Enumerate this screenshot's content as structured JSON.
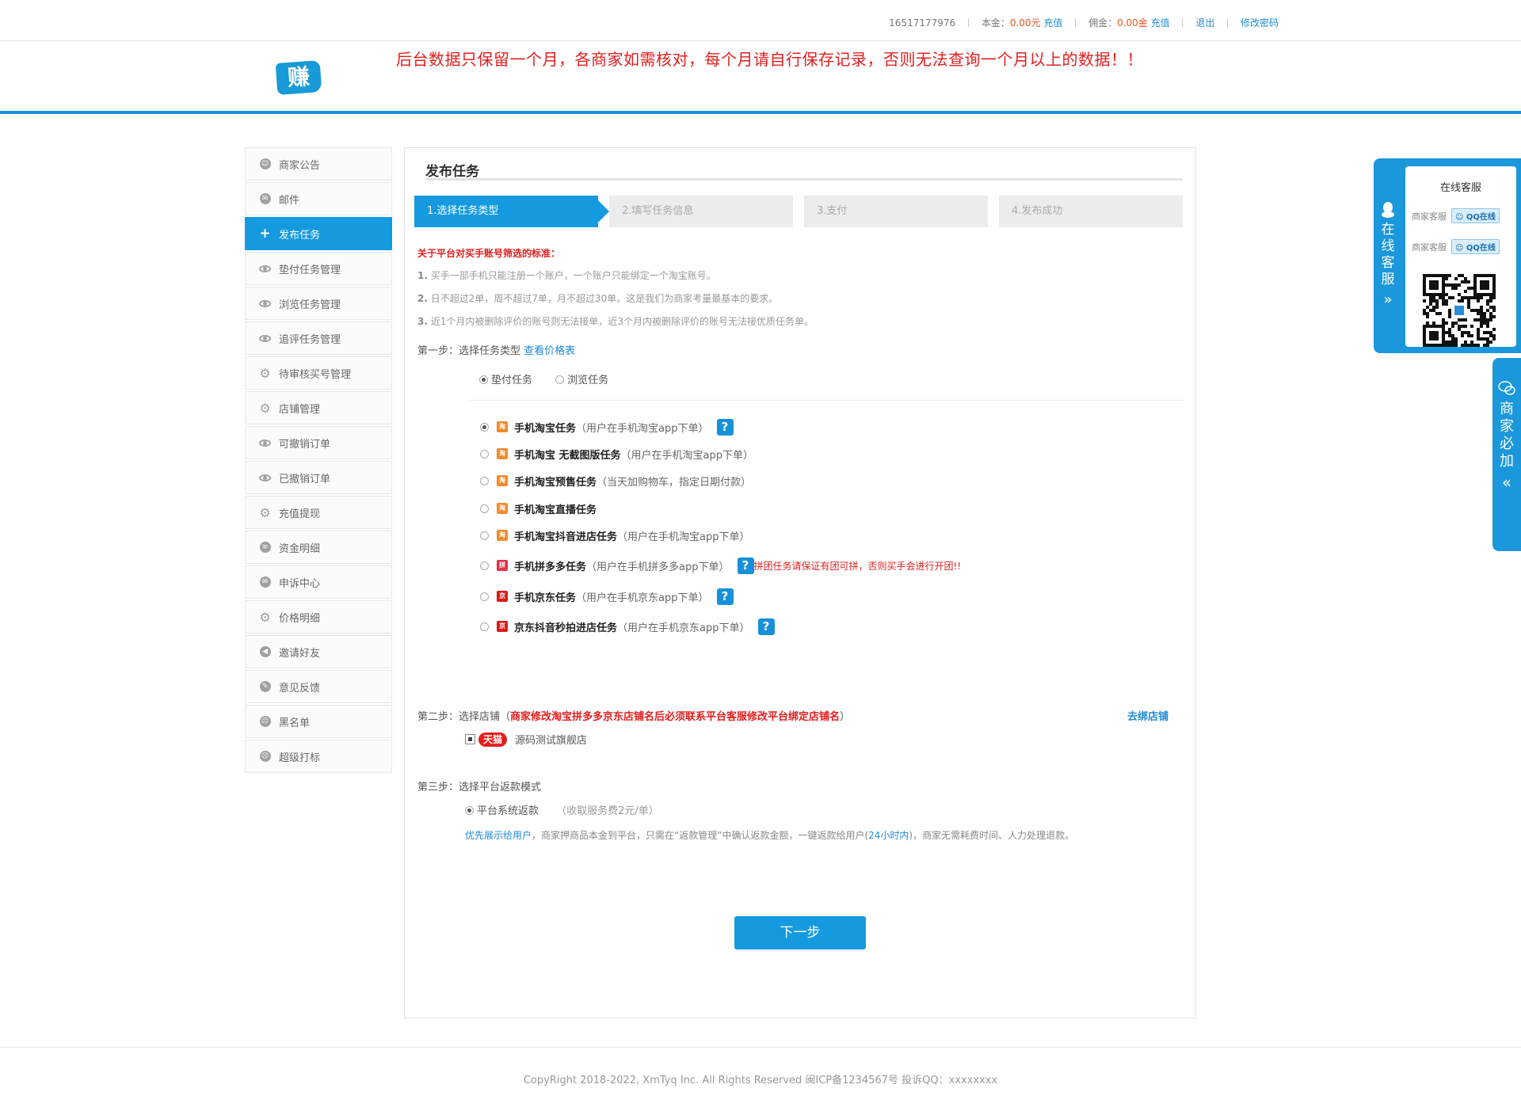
{
  "topbar": {
    "phone": "16517177976",
    "principal_label": "本金：",
    "principal_value": "0.00元",
    "recharge1": "充值",
    "commission_label": "佣金：",
    "commission_value": "0.00金",
    "recharge2": "充值",
    "logout": "退出",
    "change_password": "修改密码"
  },
  "header": {
    "logo_text": "赚",
    "notice": "后台数据只保留一个月，各商家如需核对，每个月请自行保存记录，否则无法查询一个月以上的数据！！"
  },
  "sidebar": {
    "items": [
      {
        "label": "商家公告",
        "icon": "smile-icon"
      },
      {
        "label": "邮件",
        "icon": "chat-icon"
      },
      {
        "label": "发布任务",
        "icon": "plus-icon",
        "active": true
      },
      {
        "label": "垫付任务管理",
        "icon": "eye-icon"
      },
      {
        "label": "浏览任务管理",
        "icon": "eye-icon"
      },
      {
        "label": "追评任务管理",
        "icon": "eye-icon"
      },
      {
        "label": "待审核买号管理",
        "icon": "gear-icon"
      },
      {
        "label": "店铺管理",
        "icon": "gear-icon"
      },
      {
        "label": "可撤销订单",
        "icon": "eye-icon"
      },
      {
        "label": "已撤销订单",
        "icon": "eye-icon"
      },
      {
        "label": "充值提现",
        "icon": "gear-icon"
      },
      {
        "label": "资金明细",
        "icon": "database-icon"
      },
      {
        "label": "申诉中心",
        "icon": "chat-icon"
      },
      {
        "label": "价格明细",
        "icon": "gear-icon"
      },
      {
        "label": "邀请好友",
        "icon": "megaphone-icon"
      },
      {
        "label": "意见反馈",
        "icon": "feedback-icon"
      },
      {
        "label": "黑名单",
        "icon": "sad-icon"
      },
      {
        "label": "超级打标",
        "icon": "sad-icon"
      }
    ]
  },
  "main": {
    "title": "发布任务",
    "steps": [
      "1.选择任务类型",
      "2.填写任务信息",
      "3.支付",
      "4.发布成功"
    ],
    "rules_title": "关于平台对买手账号筛选的标准：",
    "rules": [
      {
        "num": "1.",
        "text": "买手一部手机只能注册一个账户，一个账户只能绑定一个淘宝账号。"
      },
      {
        "num": "2.",
        "text": "日不超过2单，周不超过7单，月不超过30单。这是我们为商家考量最基本的要求。"
      },
      {
        "num": "3.",
        "text": "近1个月内被删除评价的账号则无法接单，近3个月内被删除评价的账号无法接优质任务单。"
      }
    ],
    "step1_label": "第一步：选择任务类型",
    "price_link": "查看价格表",
    "task_kinds": [
      "垫付任务",
      "浏览任务"
    ],
    "tasks": [
      {
        "badge": "淘",
        "name": "手机淘宝任务",
        "desc": "（用户在手机淘宝app下单）",
        "help": "?"
      },
      {
        "badge": "淘",
        "name": "手机淘宝 无截图版任务",
        "desc": "（用户在手机淘宝app下单）"
      },
      {
        "badge": "淘",
        "name": "手机淘宝预售任务",
        "desc": "（当天加购物车，指定日期付款）"
      },
      {
        "badge": "淘",
        "name": "手机淘宝直播任务",
        "desc": ""
      },
      {
        "badge": "淘",
        "name": "手机淘宝抖音进店任务",
        "desc": "（用户在手机淘宝app下单）"
      },
      {
        "badge": "拼",
        "name": "手机拼多多任务",
        "desc": "（用户在手机拼多多app下单）",
        "help": "?",
        "warn": "拼团任务请保证有团可拼，否则买手会进行开团!!"
      },
      {
        "badge": "京",
        "name": "手机京东任务",
        "desc": "（用户在手机京东app下单）",
        "help": "?"
      },
      {
        "badge": "京",
        "name": "京东抖音秒拍进店任务",
        "desc": "（用户在手机京东app下单）",
        "help": "?"
      }
    ],
    "step2_label": "第二步：选择店铺（",
    "step2_warn": "商家修改淘宝拼多多京东店铺名后必须联系平台客服修改平台绑定店铺名",
    "step2_close": "）",
    "bind_shop": "去绑店铺",
    "shop_tag": "天猫",
    "shop_name": "源码测试旗舰店",
    "step3_label": "第三步：选择平台返款模式",
    "refund_mode": "平台系统返款",
    "refund_fee": "（收取服务费2元/单）",
    "refund_desc_pre": "优先展示给用户",
    "refund_desc_mid": "，商家押商品本金到平台，只需在“返款管理”中确认返款金额，一键返款给用户(",
    "refund_desc_hl": "24小时内",
    "refund_desc_post": ")，商家无需耗费时间、人力处理退款。",
    "next_button": "下一步"
  },
  "footer": {
    "text": "CopyRight 2018-2022, XmTyq Inc. All Rights Reserved 闽ICP备1234567号 投诉QQ：xxxxxxxx"
  },
  "service": {
    "tab_text": "在线客服",
    "title": "在线客服",
    "rows": [
      {
        "label": "商家客服",
        "btn": "QQ在线"
      },
      {
        "label": "商家客服",
        "btn": "QQ在线"
      }
    ],
    "must_add": "商家必加"
  },
  "colors": {
    "accent": "#159ae0",
    "warning": "#e31e1e",
    "link": "#1f8bd7"
  }
}
